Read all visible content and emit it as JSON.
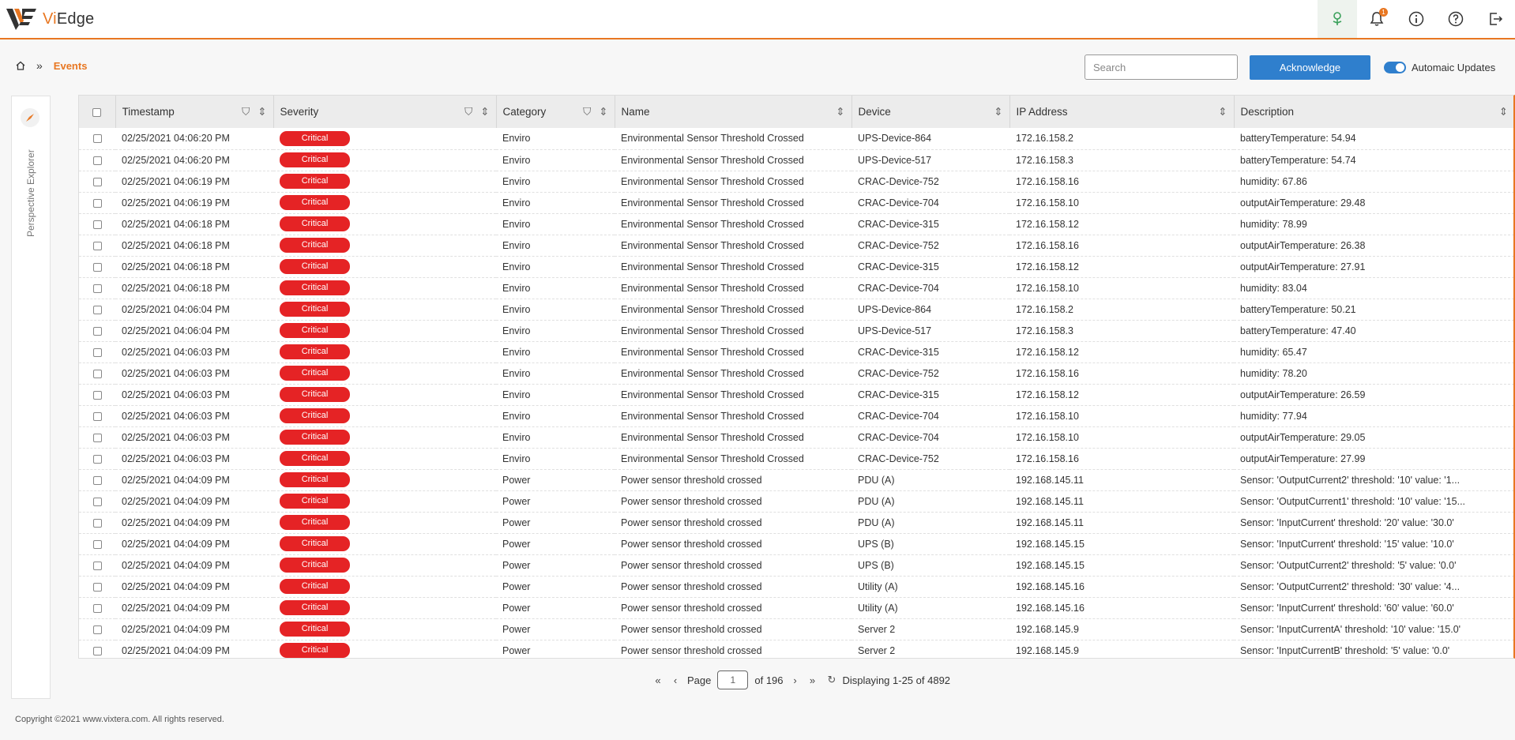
{
  "app": {
    "title_prefix": "Vi",
    "title_suffix": "Edge"
  },
  "header_icons": {
    "activity": "tree-icon",
    "notifications_badge": "1"
  },
  "breadcrumb": {
    "current": "Events",
    "separator": "»"
  },
  "toolbar": {
    "search_placeholder": "Search",
    "acknowledge_label": "Acknowledge",
    "auto_updates_label": "Automaic Updates"
  },
  "side_panel": {
    "label": "Perspective Explorer"
  },
  "columns": {
    "timestamp": "Timestamp",
    "severity": "Severity",
    "category": "Category",
    "name": "Name",
    "device": "Device",
    "ip": "IP Address",
    "description": "Description"
  },
  "rows": [
    {
      "timestamp": "02/25/2021 04:06:20 PM",
      "severity": "Critical",
      "category": "Enviro",
      "name": "Environmental Sensor Threshold Crossed",
      "device": "UPS-Device-864",
      "ip": "172.16.158.2",
      "description": "batteryTemperature: 54.94"
    },
    {
      "timestamp": "02/25/2021 04:06:20 PM",
      "severity": "Critical",
      "category": "Enviro",
      "name": "Environmental Sensor Threshold Crossed",
      "device": "UPS-Device-517",
      "ip": "172.16.158.3",
      "description": "batteryTemperature: 54.74"
    },
    {
      "timestamp": "02/25/2021 04:06:19 PM",
      "severity": "Critical",
      "category": "Enviro",
      "name": "Environmental Sensor Threshold Crossed",
      "device": "CRAC-Device-752",
      "ip": "172.16.158.16",
      "description": "humidity: 67.86"
    },
    {
      "timestamp": "02/25/2021 04:06:19 PM",
      "severity": "Critical",
      "category": "Enviro",
      "name": "Environmental Sensor Threshold Crossed",
      "device": "CRAC-Device-704",
      "ip": "172.16.158.10",
      "description": "outputAirTemperature: 29.48"
    },
    {
      "timestamp": "02/25/2021 04:06:18 PM",
      "severity": "Critical",
      "category": "Enviro",
      "name": "Environmental Sensor Threshold Crossed",
      "device": "CRAC-Device-315",
      "ip": "172.16.158.12",
      "description": "humidity: 78.99"
    },
    {
      "timestamp": "02/25/2021 04:06:18 PM",
      "severity": "Critical",
      "category": "Enviro",
      "name": "Environmental Sensor Threshold Crossed",
      "device": "CRAC-Device-752",
      "ip": "172.16.158.16",
      "description": "outputAirTemperature: 26.38"
    },
    {
      "timestamp": "02/25/2021 04:06:18 PM",
      "severity": "Critical",
      "category": "Enviro",
      "name": "Environmental Sensor Threshold Crossed",
      "device": "CRAC-Device-315",
      "ip": "172.16.158.12",
      "description": "outputAirTemperature: 27.91"
    },
    {
      "timestamp": "02/25/2021 04:06:18 PM",
      "severity": "Critical",
      "category": "Enviro",
      "name": "Environmental Sensor Threshold Crossed",
      "device": "CRAC-Device-704",
      "ip": "172.16.158.10",
      "description": "humidity: 83.04"
    },
    {
      "timestamp": "02/25/2021 04:06:04 PM",
      "severity": "Critical",
      "category": "Enviro",
      "name": "Environmental Sensor Threshold Crossed",
      "device": "UPS-Device-864",
      "ip": "172.16.158.2",
      "description": "batteryTemperature: 50.21"
    },
    {
      "timestamp": "02/25/2021 04:06:04 PM",
      "severity": "Critical",
      "category": "Enviro",
      "name": "Environmental Sensor Threshold Crossed",
      "device": "UPS-Device-517",
      "ip": "172.16.158.3",
      "description": "batteryTemperature: 47.40"
    },
    {
      "timestamp": "02/25/2021 04:06:03 PM",
      "severity": "Critical",
      "category": "Enviro",
      "name": "Environmental Sensor Threshold Crossed",
      "device": "CRAC-Device-315",
      "ip": "172.16.158.12",
      "description": "humidity: 65.47"
    },
    {
      "timestamp": "02/25/2021 04:06:03 PM",
      "severity": "Critical",
      "category": "Enviro",
      "name": "Environmental Sensor Threshold Crossed",
      "device": "CRAC-Device-752",
      "ip": "172.16.158.16",
      "description": "humidity: 78.20"
    },
    {
      "timestamp": "02/25/2021 04:06:03 PM",
      "severity": "Critical",
      "category": "Enviro",
      "name": "Environmental Sensor Threshold Crossed",
      "device": "CRAC-Device-315",
      "ip": "172.16.158.12",
      "description": "outputAirTemperature: 26.59"
    },
    {
      "timestamp": "02/25/2021 04:06:03 PM",
      "severity": "Critical",
      "category": "Enviro",
      "name": "Environmental Sensor Threshold Crossed",
      "device": "CRAC-Device-704",
      "ip": "172.16.158.10",
      "description": "humidity: 77.94"
    },
    {
      "timestamp": "02/25/2021 04:06:03 PM",
      "severity": "Critical",
      "category": "Enviro",
      "name": "Environmental Sensor Threshold Crossed",
      "device": "CRAC-Device-704",
      "ip": "172.16.158.10",
      "description": "outputAirTemperature: 29.05"
    },
    {
      "timestamp": "02/25/2021 04:06:03 PM",
      "severity": "Critical",
      "category": "Enviro",
      "name": "Environmental Sensor Threshold Crossed",
      "device": "CRAC-Device-752",
      "ip": "172.16.158.16",
      "description": "outputAirTemperature: 27.99"
    },
    {
      "timestamp": "02/25/2021 04:04:09 PM",
      "severity": "Critical",
      "category": "Power",
      "name": "Power sensor threshold crossed",
      "device": "PDU (A)",
      "ip": "192.168.145.11",
      "description": "Sensor: 'OutputCurrent2' threshold: '10' value: '1..."
    },
    {
      "timestamp": "02/25/2021 04:04:09 PM",
      "severity": "Critical",
      "category": "Power",
      "name": "Power sensor threshold crossed",
      "device": "PDU (A)",
      "ip": "192.168.145.11",
      "description": "Sensor: 'OutputCurrent1' threshold: '10' value: '15..."
    },
    {
      "timestamp": "02/25/2021 04:04:09 PM",
      "severity": "Critical",
      "category": "Power",
      "name": "Power sensor threshold crossed",
      "device": "PDU (A)",
      "ip": "192.168.145.11",
      "description": "Sensor: 'InputCurrent' threshold: '20' value: '30.0'"
    },
    {
      "timestamp": "02/25/2021 04:04:09 PM",
      "severity": "Critical",
      "category": "Power",
      "name": "Power sensor threshold crossed",
      "device": "UPS (B)",
      "ip": "192.168.145.15",
      "description": "Sensor: 'InputCurrent' threshold: '15' value: '10.0'"
    },
    {
      "timestamp": "02/25/2021 04:04:09 PM",
      "severity": "Critical",
      "category": "Power",
      "name": "Power sensor threshold crossed",
      "device": "UPS (B)",
      "ip": "192.168.145.15",
      "description": "Sensor: 'OutputCurrent2' threshold: '5' value: '0.0'"
    },
    {
      "timestamp": "02/25/2021 04:04:09 PM",
      "severity": "Critical",
      "category": "Power",
      "name": "Power sensor threshold crossed",
      "device": "Utility (A)",
      "ip": "192.168.145.16",
      "description": "Sensor: 'OutputCurrent2' threshold: '30' value: '4..."
    },
    {
      "timestamp": "02/25/2021 04:04:09 PM",
      "severity": "Critical",
      "category": "Power",
      "name": "Power sensor threshold crossed",
      "device": "Utility (A)",
      "ip": "192.168.145.16",
      "description": "Sensor: 'InputCurrent' threshold: '60' value: '60.0'"
    },
    {
      "timestamp": "02/25/2021 04:04:09 PM",
      "severity": "Critical",
      "category": "Power",
      "name": "Power sensor threshold crossed",
      "device": "Server 2",
      "ip": "192.168.145.9",
      "description": "Sensor: 'InputCurrentA' threshold: '10' value: '15.0'"
    },
    {
      "timestamp": "02/25/2021 04:04:09 PM",
      "severity": "Critical",
      "category": "Power",
      "name": "Power sensor threshold crossed",
      "device": "Server 2",
      "ip": "192.168.145.9",
      "description": "Sensor: 'InputCurrentB' threshold: '5' value: '0.0'"
    }
  ],
  "pager": {
    "page_label": "Page",
    "page_value": "1",
    "of_label": "of 196",
    "displaying": "Displaying 1-25 of 4892"
  },
  "footer": {
    "copyright": "Copyright ©2021 www.vixtera.com. All rights reserved."
  },
  "colors": {
    "accent": "#e87722",
    "primary": "#2f7fcd",
    "critical": "#e52325"
  }
}
